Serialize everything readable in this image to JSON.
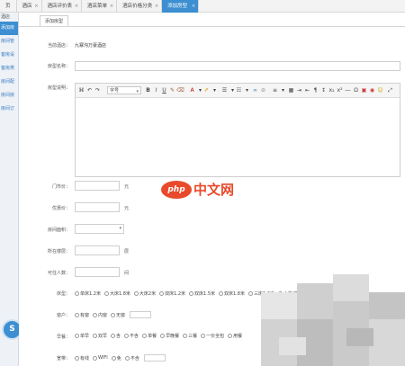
{
  "topbar": {
    "tabs": [
      {
        "label": "页",
        "active": false
      },
      {
        "label": "酒店",
        "active": false
      },
      {
        "label": "酒店评价表",
        "active": false
      },
      {
        "label": "酒店菜单",
        "active": false
      },
      {
        "label": "酒店价格分类",
        "active": false
      },
      {
        "label": "添加房型",
        "active": true
      }
    ]
  },
  "sidebar": {
    "head": "酒店",
    "items": [
      "添加房",
      "房间管",
      "客房设",
      "客房类",
      "房间配",
      "房间房",
      "房间订"
    ]
  },
  "inner_tab": "添加房型",
  "form": {
    "hotel_label": "当前酒店：",
    "hotel_value": "九寨沟万豪酒店",
    "type_name_label": "房型名称：",
    "description_label": "房型说明：",
    "editor_font_select": "字号",
    "market_price_label": "门市价：",
    "market_price_unit": "元",
    "discount_price_label": "优惠价：",
    "discount_price_unit": "元",
    "area_label": "房间面积：",
    "floor_label": "所在楼层：",
    "floor_unit": "层",
    "guests_label": "可住人数：",
    "guests_unit": "间",
    "bed_label": "床型：",
    "bed_options": [
      "单床1.2米",
      "大床1.8米",
      "大床2米",
      "双床1.2米",
      "双床1.5米",
      "双床1.8米",
      "三床1.2米",
      "大床/双床"
    ],
    "window_label": "窗户：",
    "window_options": [
      "有窗",
      "内窗",
      "无窗"
    ],
    "breakfast_label": "早餐：",
    "breakfast_options": [
      "单早",
      "双早",
      "含",
      "不含",
      "单餐",
      "早晚餐",
      "三餐",
      "一价全包",
      "用餐"
    ],
    "broadband_label": "宽带：",
    "broadband_options": [
      "有线",
      "WIFI",
      "免",
      "不含"
    ]
  },
  "watermark": {
    "php": "php",
    "text": "中文网"
  },
  "colors": {
    "accent": "#3d8fd1",
    "watermark": "#e84a2b"
  }
}
